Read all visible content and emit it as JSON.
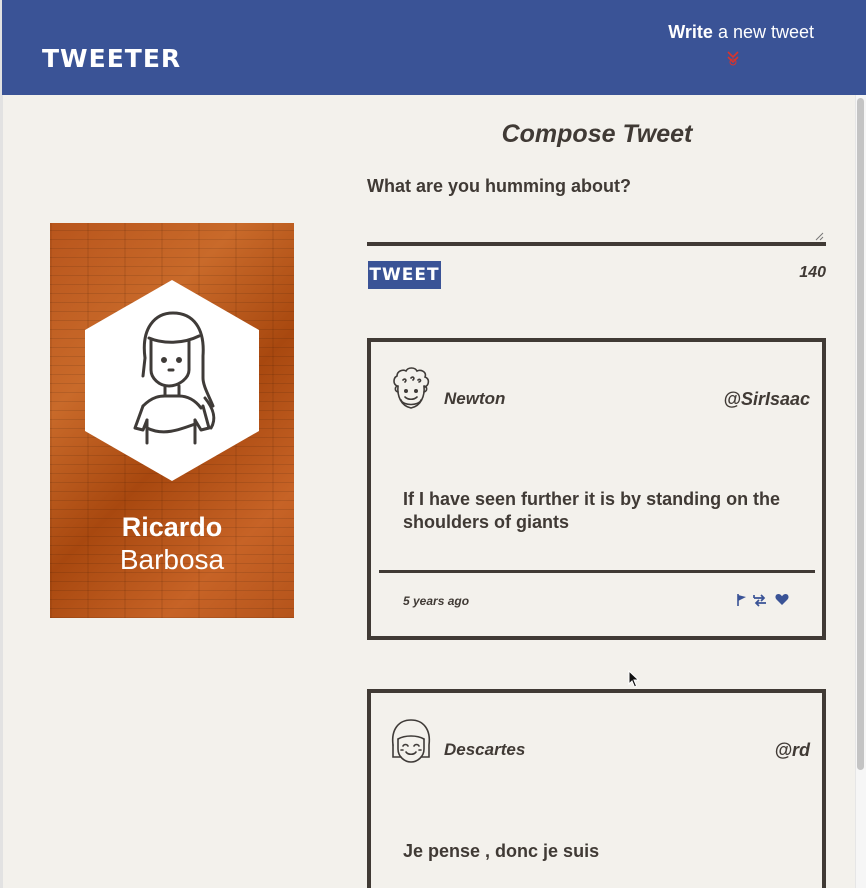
{
  "nav": {
    "logo": "TWEETER",
    "write_bold": "Write",
    "write_rest": " a new tweet",
    "arrow_icon": "double-chevron-down-icon",
    "arrow_color": "#d9342b"
  },
  "profile": {
    "first_name": "Ricardo",
    "last_name": "Barbosa",
    "avatar_icon": "woman-avatar-icon"
  },
  "compose": {
    "title": "Compose Tweet",
    "placeholder": "What are you humming about?",
    "button_label": "TWEET",
    "counter": "140"
  },
  "tweets": [
    {
      "name": "Newton",
      "handle": "@SirIsaac",
      "avatar_icon": "curly-hair-man-avatar-icon",
      "text": "If I have seen further it is by standing on the shoulders of giants",
      "time": "5 years ago",
      "actions": [
        "flag-icon",
        "retweet-icon",
        "heart-icon"
      ]
    },
    {
      "name": "Descartes",
      "handle": "@rd",
      "avatar_icon": "smiling-bob-hair-avatar-icon",
      "text": "Je pense , donc je suis"
    }
  ],
  "colors": {
    "nav_bg": "#3a5396",
    "page_bg": "#f3f1ec",
    "text": "#403a35",
    "accent": "#3a5396"
  }
}
